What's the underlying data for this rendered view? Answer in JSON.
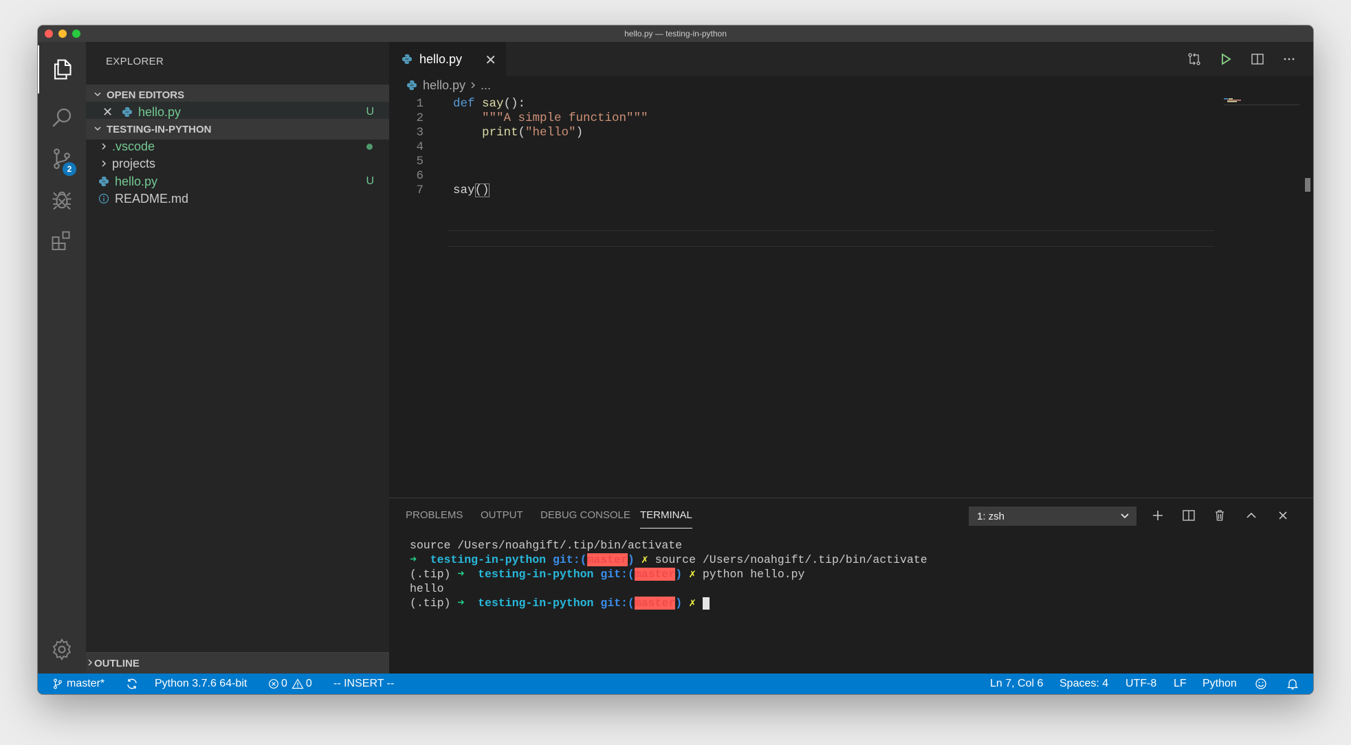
{
  "window": {
    "title": "hello.py — testing-in-python"
  },
  "activity_bar": {
    "scm_badge": "2"
  },
  "sidebar": {
    "title": "EXPLORER",
    "open_editors": {
      "header": "OPEN EDITORS",
      "items": [
        {
          "label": "hello.py",
          "status": "U"
        }
      ]
    },
    "folder": {
      "header": "TESTING-IN-PYTHON",
      "items": [
        {
          "label": ".vscode"
        },
        {
          "label": "projects"
        },
        {
          "label": "hello.py",
          "status": "U"
        },
        {
          "label": "README.md"
        }
      ]
    },
    "outline": "OUTLINE"
  },
  "editor": {
    "tab": {
      "label": "hello.py"
    },
    "breadcrumb": {
      "file": "hello.py",
      "rest": "..."
    },
    "line_numbers": [
      "1",
      "2",
      "3",
      "4",
      "5",
      "6",
      "7"
    ],
    "code": {
      "l1_kw": "def",
      "l1_fn": "say",
      "l1_rest": "():",
      "l2_str": "\"\"\"A simple function\"\"\"",
      "l3_fn": "print",
      "l3_open": "(",
      "l3_str": "\"hello\"",
      "l3_close": ")",
      "l7_fn": "say",
      "l7_rest": "()"
    }
  },
  "panel": {
    "tabs": [
      "PROBLEMS",
      "OUTPUT",
      "DEBUG CONSOLE",
      "TERMINAL"
    ],
    "active_tab": "TERMINAL",
    "terminal_select": "1: zsh",
    "terminal": {
      "line1": "source /Users/noahgift/.tip/bin/activate",
      "prompt_arrow": "➜",
      "dir": "testing-in-python",
      "git": "git:(",
      "branch": "master",
      "git_close": ")",
      "x": "✗",
      "cmd2": "source /Users/noahgift/.tip/bin/activate",
      "venv": "(.tip)",
      "cmd3": "python hello.py",
      "output": "hello"
    }
  },
  "statusbar": {
    "branch": "master*",
    "python": "Python 3.7.6 64-bit",
    "errors": "0",
    "warnings": "0",
    "mode": "-- INSERT --",
    "position": "Ln 7, Col 6",
    "spaces": "Spaces: 4",
    "encoding": "UTF-8",
    "eol": "LF",
    "language": "Python"
  },
  "colors": {
    "accent": "#007acc",
    "untracked": "#73c991",
    "editor_bg": "#1e1e1e"
  }
}
